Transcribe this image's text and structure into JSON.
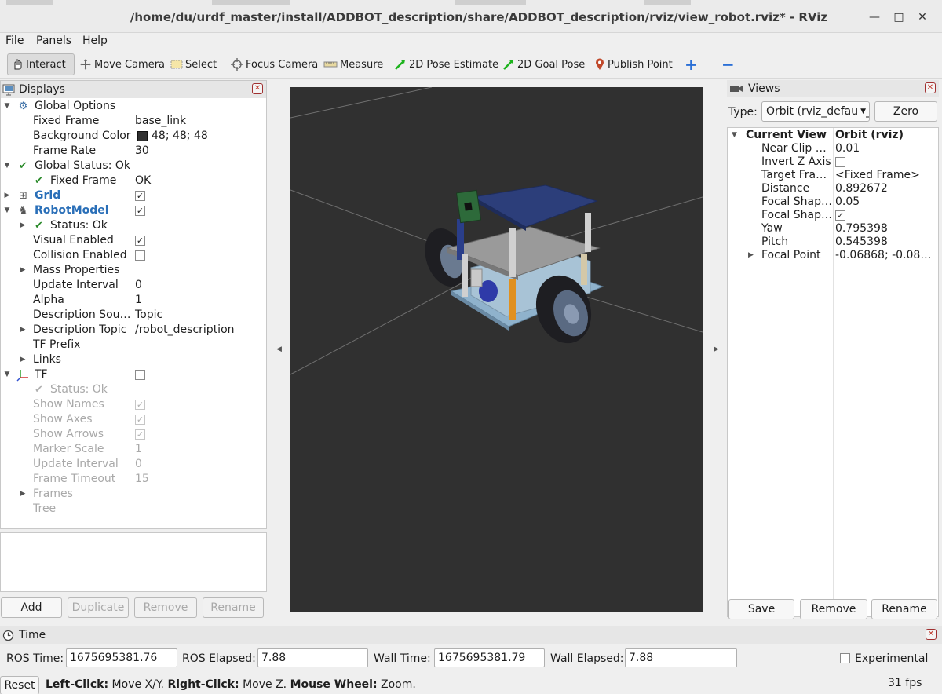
{
  "window": {
    "title": "/home/du/urdf_master/install/ADDBOT_description/share/ADDBOT_description/rviz/view_robot.rviz* - RViz",
    "minimize": "—",
    "maximize": "□",
    "close": "✕"
  },
  "menu": {
    "file": "File",
    "panels": "Panels",
    "help": "Help"
  },
  "toolbar": {
    "interact": "Interact",
    "move_camera": "Move Camera",
    "select": "Select",
    "focus_camera": "Focus Camera",
    "measure": "Measure",
    "pose_estimate": "2D Pose Estimate",
    "goal_pose": "2D Goal Pose",
    "publish_point": "Publish Point",
    "add_tool": "+",
    "remove_tool": "−"
  },
  "displays": {
    "title": "Displays",
    "global_options": "Global Options",
    "fixed_frame_label": "Fixed Frame",
    "fixed_frame_value": "base_link",
    "bg_color_label": "Background Color",
    "bg_color_value": "48; 48; 48",
    "frame_rate_label": "Frame Rate",
    "frame_rate_value": "30",
    "global_status": "Global Status: Ok",
    "gs_fixed_frame": "Fixed Frame",
    "gs_fixed_frame_value": "OK",
    "grid": "Grid",
    "robot_model": "RobotModel",
    "rm_status": "Status: Ok",
    "visual_enabled": "Visual Enabled",
    "collision_enabled": "Collision Enabled",
    "mass_properties": "Mass Properties",
    "update_interval": "Update Interval",
    "update_interval_value": "0",
    "alpha": "Alpha",
    "alpha_value": "1",
    "description_source": "Description Sou…",
    "description_source_value": "Topic",
    "description_topic": "Description Topic",
    "description_topic_value": "/robot_description",
    "tf_prefix": "TF Prefix",
    "links": "Links",
    "tf": "TF",
    "tf_status": "Status: Ok",
    "show_names": "Show Names",
    "show_axes": "Show Axes",
    "show_arrows": "Show Arrows",
    "marker_scale": "Marker Scale",
    "marker_scale_value": "1",
    "tf_update_interval": "Update Interval",
    "tf_update_interval_value": "0",
    "frame_timeout": "Frame Timeout",
    "frame_timeout_value": "15",
    "frames": "Frames",
    "tree": "Tree",
    "buttons": {
      "add": "Add",
      "duplicate": "Duplicate",
      "remove": "Remove",
      "rename": "Rename"
    }
  },
  "views": {
    "title": "Views",
    "type_label": "Type:",
    "type_value": "Orbit (rviz_default_plugins)",
    "zero": "Zero",
    "current_view": "Current View",
    "current_view_value": "Orbit (rviz)",
    "props": [
      {
        "name": "Near Clip …",
        "value": "0.01"
      },
      {
        "name": "Invert Z Axis",
        "value": ""
      },
      {
        "name": "Target Fra…",
        "value": "<Fixed Frame>"
      },
      {
        "name": "Distance",
        "value": "0.892672"
      },
      {
        "name": "Focal Shap…",
        "value": "0.05"
      },
      {
        "name": "Focal Shap…",
        "value": ""
      },
      {
        "name": "Yaw",
        "value": "0.795398"
      },
      {
        "name": "Pitch",
        "value": "0.545398"
      },
      {
        "name": "Focal Point",
        "value": "-0.06868; -0.081…"
      }
    ],
    "buttons": {
      "save": "Save",
      "remove": "Remove",
      "rename": "Rename"
    }
  },
  "time": {
    "title": "Time",
    "ros_time_label": "ROS Time:",
    "ros_time": "1675695381.76",
    "ros_elapsed_label": "ROS Elapsed:",
    "ros_elapsed": "7.88",
    "wall_time_label": "Wall Time:",
    "wall_time": "1675695381.79",
    "wall_elapsed_label": "Wall Elapsed:",
    "wall_elapsed": "7.88",
    "experimental": "Experimental"
  },
  "status": {
    "reset": "Reset",
    "left_click": "Left-Click:",
    "left_click_action": " Move X/Y. ",
    "right_click": "Right-Click:",
    "right_click_action": " Move Z. ",
    "wheel": "Mouse Wheel:",
    "wheel_action": " Zoom.",
    "fps": "31 fps"
  },
  "colors": {
    "background": "#303030",
    "accent_blue": "#2a6fb8",
    "status_green": "#2a8a2a",
    "close_red": "#c0392b",
    "robot_top_plate": "#2c3e7a",
    "robot_base": "#8fb2cc"
  }
}
